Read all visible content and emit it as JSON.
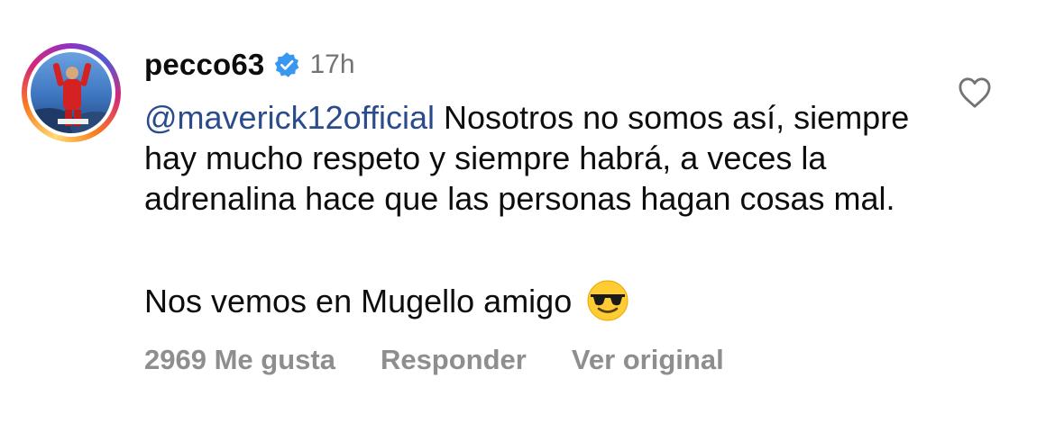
{
  "comment": {
    "username": "pecco63",
    "timestamp": "17h",
    "mention": "@maverick12official",
    "text": "Nosotros no somos así, siempre hay mucho respeto y siempre habrá, a veces la adrenalina hace que las personas hagan cosas mal.",
    "text2": "Nos vemos en Mugello amigo",
    "likes": "2969 Me gusta",
    "reply": "Responder",
    "see_original": "Ver original"
  },
  "icons": {
    "verified": "verified-badge-icon",
    "emoji": "smiling-face-with-sunglasses-emoji",
    "like": "heart-outline-icon"
  },
  "colors": {
    "mention": "#2b4c8c",
    "verified": "#3897f0",
    "secondary_text": "#8e8e8e"
  }
}
